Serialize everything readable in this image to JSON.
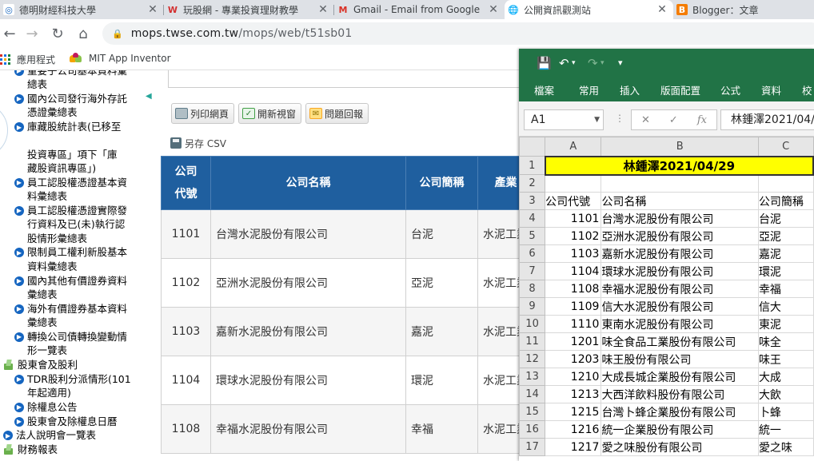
{
  "browser": {
    "tabs": [
      {
        "title": "德明財經科技大學",
        "icon": "university-favicon-icon",
        "active": false
      },
      {
        "title": "玩股網 - 專業投資理財教學",
        "icon": "wantgoo-favicon-icon",
        "active": false
      },
      {
        "title": "Gmail - Email from Google",
        "icon": "gmail-favicon-icon",
        "active": false
      },
      {
        "title": "公開資訊觀測站",
        "icon": "globe-favicon-icon",
        "active": true
      },
      {
        "title": "Blogger：文章",
        "icon": "blogger-favicon-icon",
        "active": false
      }
    ],
    "url_host": "mops.twse.com.tw",
    "url_path": "/mops/web/t51sb01",
    "bookmarks": [
      {
        "label": "應用程式"
      },
      {
        "label": "MIT App Inventor"
      }
    ]
  },
  "nav": {
    "items": [
      {
        "type": "bullet",
        "text": "重要子公司基本資料彙\n總表"
      },
      {
        "type": "bullet",
        "text": "國內公司發行海外存託\n憑證彙總表"
      },
      {
        "type": "bullet",
        "text": "庫藏股統計表(已移至\n\n投資專區」項下「庫\n藏股資訊專區」)"
      },
      {
        "type": "bullet",
        "text": "員工認股權憑證基本資\n料彙總表"
      },
      {
        "type": "bullet",
        "text": "員工認股權憑證實際發\n行資料及已(未)執行認\n股情形彙總表"
      },
      {
        "type": "bullet",
        "text": "限制員工權利新股基本\n資料彙總表"
      },
      {
        "type": "bullet",
        "text": "國內其他有價證券資料\n彙總表"
      },
      {
        "type": "bullet",
        "text": "海外有價證券基本資料\n彙總表"
      },
      {
        "type": "bullet",
        "text": "轉換公司債轉換變動情\n形一覽表"
      },
      {
        "type": "folder",
        "text": "股東會及股利"
      },
      {
        "type": "bullet",
        "text": "TDR股利分派情形(101\n年起適用)"
      },
      {
        "type": "bullet",
        "text": "除權息公告"
      },
      {
        "type": "bullet",
        "text": "股東會及除權息日曆"
      },
      {
        "type": "bullet",
        "text": "法人說明會一覽表"
      },
      {
        "type": "folder",
        "text": "財務報表"
      }
    ]
  },
  "page": {
    "buttons": {
      "print": "列印網頁",
      "new_window": "開新視窗",
      "report": "問題回報",
      "save_csv": "另存 CSV"
    },
    "table": {
      "headers": [
        "公司\n代號",
        "公司名稱",
        "公司簡稱",
        "產業"
      ],
      "rows": [
        [
          "1101",
          "台灣水泥股份有限公司",
          "台泥",
          "水泥工業"
        ],
        [
          "1102",
          "亞洲水泥股份有限公司",
          "亞泥",
          "水泥工業"
        ],
        [
          "1103",
          "嘉新水泥股份有限公司",
          "嘉泥",
          "水泥工業"
        ],
        [
          "1104",
          "環球水泥股份有限公司",
          "環泥",
          "水泥工業"
        ],
        [
          "1108",
          "幸福水泥股份有限公司",
          "幸福",
          "水泥工業"
        ]
      ]
    }
  },
  "excel": {
    "ribbon_tabs": [
      "檔案",
      "常用",
      "插入",
      "版面配置",
      "公式",
      "資料",
      "校閱"
    ],
    "name_box": "A1",
    "formula": "林鍾澤2021/04/29",
    "columns": [
      "A",
      "B",
      "C"
    ],
    "title_cell": "林鍾澤2021/04/29",
    "header_row": [
      "公司代號",
      "公司名稱",
      "公司簡稱"
    ],
    "rows": [
      [
        "1101",
        "台灣水泥股份有限公司",
        "台泥"
      ],
      [
        "1102",
        "亞洲水泥股份有限公司",
        "亞泥"
      ],
      [
        "1103",
        "嘉新水泥股份有限公司",
        "嘉泥"
      ],
      [
        "1104",
        "環球水泥股份有限公司",
        "環泥"
      ],
      [
        "1108",
        "幸福水泥股份有限公司",
        "幸福"
      ],
      [
        "1109",
        "信大水泥股份有限公司",
        "信大"
      ],
      [
        "1110",
        "東南水泥股份有限公司",
        "東泥"
      ],
      [
        "1201",
        "味全食品工業股份有限公司",
        "味全"
      ],
      [
        "1203",
        "味王股份有限公司",
        "味王"
      ],
      [
        "1210",
        "大成長城企業股份有限公司",
        "大成"
      ],
      [
        "1213",
        "大西洋飲料股份有限公司",
        "大飲"
      ],
      [
        "1215",
        "台灣卜蜂企業股份有限公司",
        "卜蜂"
      ],
      [
        "1216",
        "統一企業股份有限公司",
        "統一"
      ],
      [
        "1217",
        "愛之味股份有限公司",
        "愛之味"
      ]
    ],
    "accent_color": "#217346",
    "title_fill_color": "#ffff00"
  }
}
